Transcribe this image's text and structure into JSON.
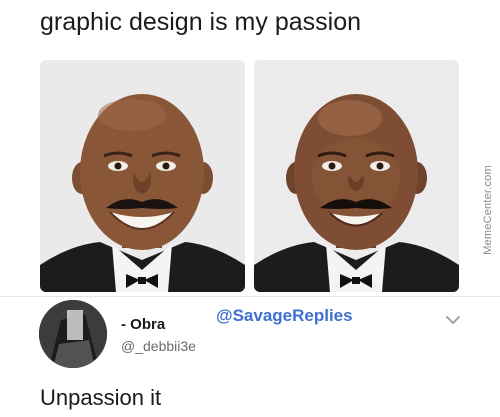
{
  "caption": "graphic design is my passion",
  "watermark": "MemeCenter.com",
  "tweet": {
    "name": "- Obra",
    "handle": "@_debbii3e",
    "tag": "@SavageReplies",
    "reply": "Unpassion it"
  },
  "icons": {
    "options": "chevron-down-icon"
  }
}
